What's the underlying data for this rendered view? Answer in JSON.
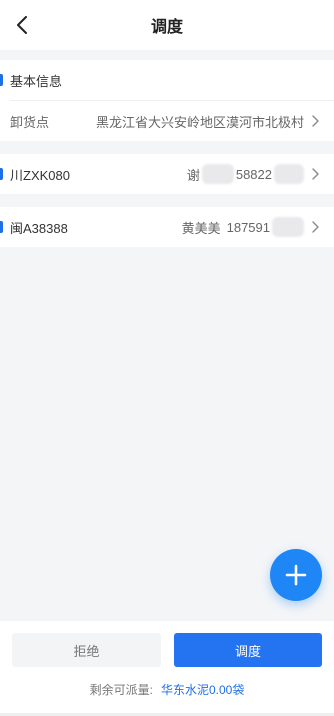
{
  "nav": {
    "title": "调度"
  },
  "basic_info": {
    "title": "基本信息",
    "unload_label": "卸货点",
    "unload_value": "黑龙江省大兴安岭地区漠河市北极村"
  },
  "vehicles": [
    {
      "plate": "川ZXK080",
      "driver_name": "谢",
      "driver_phone": "58822"
    },
    {
      "plate": "闽A38388",
      "driver_name": "黄美美",
      "driver_phone": "187591"
    }
  ],
  "footer": {
    "reject_label": "拒绝",
    "dispatch_label": "调度",
    "remain_label": "剩余可派量:",
    "remain_value": "华东水泥0.00袋"
  },
  "colors": {
    "accent": "#1f6fe8",
    "primary_button": "#2474f1",
    "fab": "#1f86f5"
  }
}
